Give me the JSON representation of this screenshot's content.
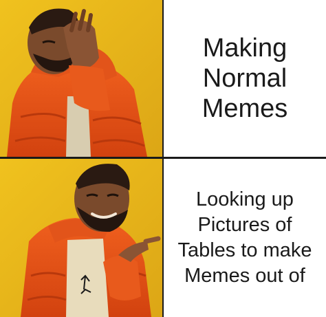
{
  "meme": {
    "top_panel": {
      "image_description_icon": "disapproving-man-icon",
      "caption": "Making\nNormal\nMemes"
    },
    "bottom_panel": {
      "image_description_icon": "approving-man-icon",
      "caption": "Looking up\nPictures of\nTables to make\nMemes out of"
    },
    "colors": {
      "background_yellow": "#e8b81c",
      "jacket_orange": "#e8501a",
      "divider": "#1a1a1a"
    }
  }
}
